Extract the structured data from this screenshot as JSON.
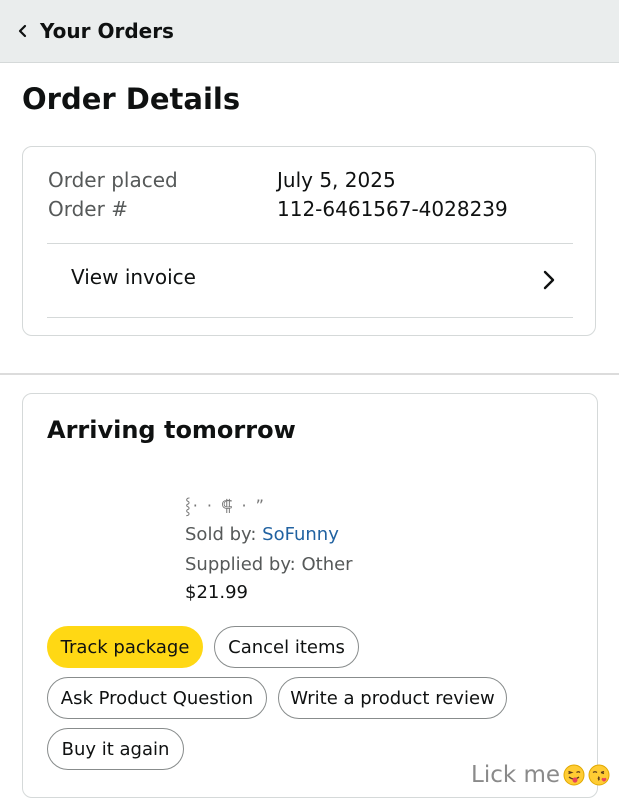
{
  "header": {
    "back_label": "Your Orders"
  },
  "page_title": "Order Details",
  "order_info": {
    "placed_label": "Order placed",
    "placed_value": "July 5, 2025",
    "number_label": "Order #",
    "number_value": "112-6461567-4028239",
    "invoice_label": "View invoice"
  },
  "shipment": {
    "status": "Arriving tomorrow",
    "product": {
      "title": "⸾· · ⸿ · ”",
      "sold_by_label": "Sold by: ",
      "seller": "SoFunny",
      "supplied_by": "Supplied by: Other",
      "price": "$21.99"
    },
    "buttons": {
      "track": "Track package",
      "cancel": "Cancel items",
      "question": "Ask Product Question",
      "review": "Write a product review",
      "again": "Buy it again"
    }
  },
  "watermark": {
    "text": "Lick me",
    "emojis": [
      "face-with-tongue-wink-icon",
      "face-blowing-kiss-icon"
    ]
  },
  "colors": {
    "track_button": "#ffd814",
    "link": "#2162a1",
    "topbar": "#eaeded"
  }
}
